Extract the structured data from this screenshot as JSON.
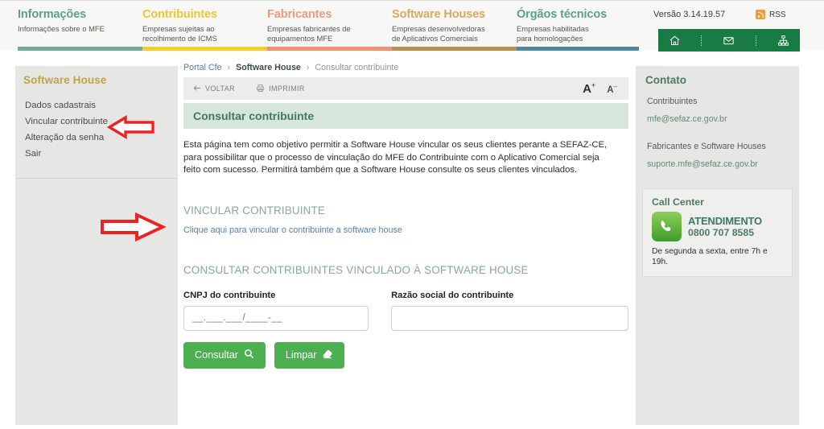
{
  "header": {
    "nav": [
      {
        "title": "Informações",
        "subtitle": "Informações sobre o MFE",
        "color": "#5aa08a",
        "bar": "#72ab9a"
      },
      {
        "title": "Contribuintes",
        "subtitle": "Empresas sujeitas ao\nrecolhimento de ICMS",
        "color": "#f0c330",
        "bar": "#f6cd2b"
      },
      {
        "title": "Fabricantes",
        "subtitle": "Empresas fabricantes de\nequipamentos MFE",
        "color": "#ef9a7e",
        "bar": "#ef9175"
      },
      {
        "title": "Software Houses",
        "subtitle": "Empresas desenvolvedoras\nde Aplicativos Comerciais",
        "color": "#d8a95f",
        "bar": "#b8914f"
      },
      {
        "title": "Órgãos técnicos",
        "subtitle": "Empresas habilitadas\npara homologações",
        "color": "#5aa08a",
        "bar": "#4f87a0"
      }
    ],
    "version": "Versão 3.14.19.57",
    "rss_label": "RSS",
    "icons": [
      {
        "name": "home-icon",
        "title": "Início"
      },
      {
        "name": "mail-icon",
        "title": "Fale conosco"
      },
      {
        "name": "sitemap-icon",
        "title": "Mapa do site"
      }
    ]
  },
  "sidebar": {
    "title": "Software House",
    "items": [
      {
        "label": "Dados cadastrais"
      },
      {
        "label": "Vincular contribuinte"
      },
      {
        "label": "Alteração da senha"
      },
      {
        "label": "Sair"
      }
    ]
  },
  "main": {
    "breadcrumb": {
      "root": "Portal Cfe",
      "section": "Software House",
      "current": "Consultar contribuinte",
      "separator": "›"
    },
    "toolbar": {
      "back_label": "VOLTAR",
      "print_label": "IMPRIMIR",
      "font_increase": "A",
      "font_increase_sup": "+",
      "font_decrease": "A",
      "font_decrease_sup": "–"
    },
    "page_title": "Consultar contribuinte",
    "intro": "Esta página tem como objetivo permitir a Software House vincular os seus clientes perante a SEFAZ-CE, para possibilitar que o processo de vinculação do MFE do Contribuinte com o Aplicativo Comercial seja feito com sucesso. Permitirá também que a Software House consulte os seus clientes vinculados.",
    "section_vincular": {
      "heading": "VINCULAR CONTRIBUINTE",
      "link": "Clique aqui para vincular o contribuinte a software house"
    },
    "section_consultar": {
      "heading": "CONSULTAR CONTRIBUINTES VINCULADO À SOFTWARE HOUSE",
      "fields": [
        {
          "label": "CNPJ do contribuinte",
          "value": "",
          "placeholder": "__.___.___/____-__"
        },
        {
          "label": "Razão social do contribuinte",
          "value": "",
          "placeholder": ""
        }
      ],
      "buttons": [
        {
          "label": "Consultar",
          "icon": "search-icon"
        },
        {
          "label": "Limpar",
          "icon": "eraser-icon"
        }
      ]
    }
  },
  "right": {
    "title": "Contato",
    "groups": [
      {
        "label": "Contribuintes",
        "email": "mfe@sefaz.ce.gov.br"
      },
      {
        "label": "Fabricantes e Software Houses",
        "email": "suporte.mfe@sefaz.ce.gov.br"
      }
    ],
    "callcenter": {
      "title": "Call Center",
      "headline": "ATENDIMENTO",
      "phone": "0800 707 8585",
      "hours": "De segunda a sexta, entre 7h e 19h."
    }
  },
  "annotations": {
    "arrow_color": "#ee2222",
    "arrow_left_target": "Vincular contribuinte",
    "arrow_right_target": "Clique aqui para vincular o contribuinte a software house"
  }
}
